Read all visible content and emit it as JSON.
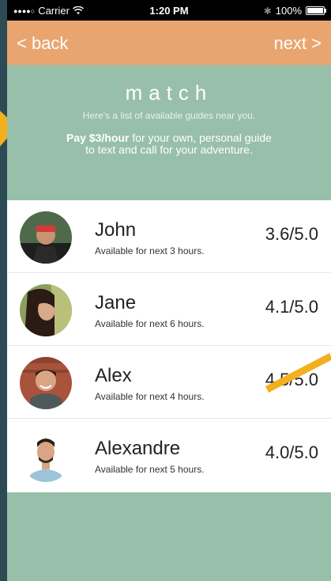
{
  "status_bar": {
    "carrier": "Carrier",
    "time": "1:20 PM",
    "battery": "100%"
  },
  "nav": {
    "back_label": "< back",
    "next_label": "next >"
  },
  "header": {
    "title": "match",
    "subtitle": "Here's a list of available guides near you.",
    "pitch_bold": "Pay $3/hour",
    "pitch_rest": " for your own, personal guide to text and call for your adventure."
  },
  "guides": [
    {
      "name": "John",
      "availability": "Available for next 3 hours.",
      "rating": "3.6/5.0"
    },
    {
      "name": "Jane",
      "availability": "Available for next 6 hours.",
      "rating": "4.1/5.0"
    },
    {
      "name": "Alex",
      "availability": "Available for next 4 hours.",
      "rating": "4.5/5.0"
    },
    {
      "name": "Alexandre",
      "availability": "Available for next 5 hours.",
      "rating": "4.0/5.0"
    }
  ],
  "colors": {
    "nav_bg": "#e9a56f",
    "page_bg": "#98bfa9",
    "annotation_arrow": "#f2b01e"
  }
}
